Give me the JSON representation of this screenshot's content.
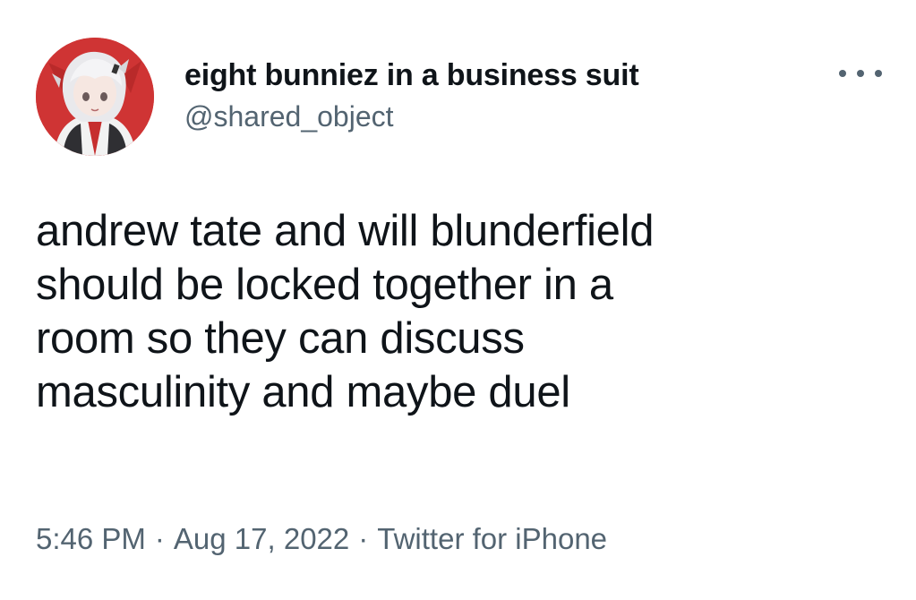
{
  "tweet": {
    "author": {
      "display_name": "eight bunniez in a business suit",
      "handle": "@shared_object",
      "avatar_icon": "anime-avatar-icon"
    },
    "more_icon": "more-horizontal-icon",
    "text": "andrew tate and will blunderfield\nshould be locked together in a\nroom so they can discuss\nmasculinity and maybe duel",
    "meta": {
      "time": "5:46 PM",
      "separator": "·",
      "date": "Aug 17, 2022",
      "source": "Twitter for iPhone"
    },
    "colors": {
      "text": "#0f1419",
      "secondary": "#536471",
      "avatar_bg": "#cf3434"
    }
  }
}
